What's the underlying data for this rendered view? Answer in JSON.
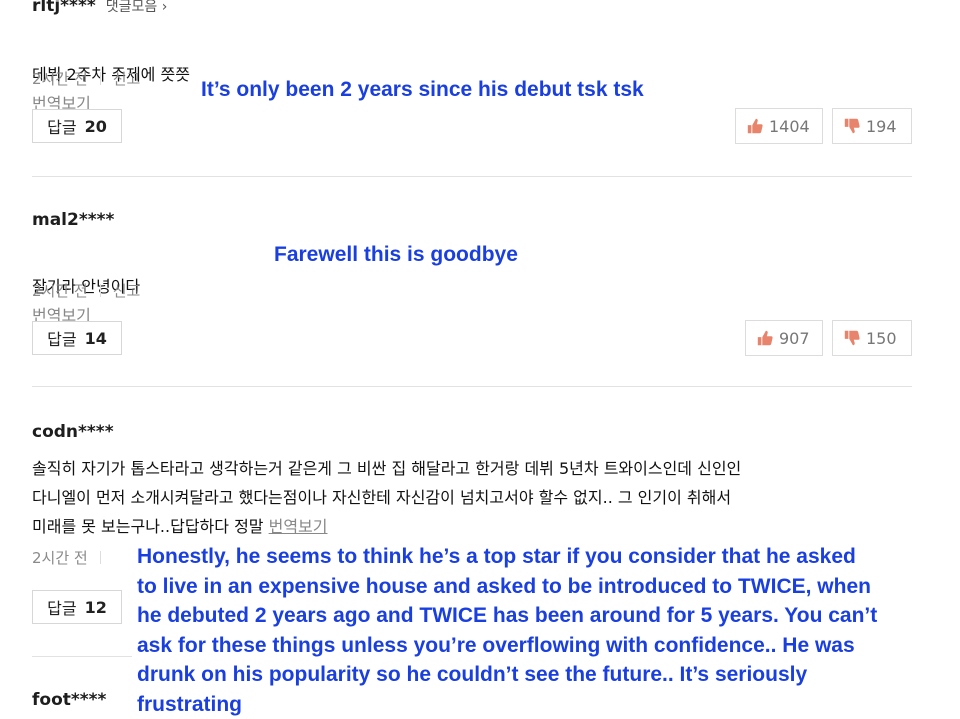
{
  "comments": [
    {
      "username": "rltj****",
      "collect_label": "댓글모음 ›",
      "text": "데뷔 2주차 주제에 쯧쯧",
      "translate_label": "번역보기",
      "time": "2시간 전",
      "report_label": "신고",
      "reply_label": "답글",
      "reply_count": "20",
      "likes": "1404",
      "dislikes": "194",
      "translation": "It’s only been 2 years since his debut tsk tsk"
    },
    {
      "username": "mal2****",
      "text": "잘가라 안녕이다",
      "translate_label": "번역보기",
      "time": "2시간 전",
      "report_label": "신고",
      "reply_label": "답글",
      "reply_count": "14",
      "likes": "907",
      "dislikes": "150",
      "translation": "Farewell this is goodbye"
    },
    {
      "username": "codn****",
      "text": "솔직히 자기가 톱스타라고 생각하는거 같은게 그 비싼 집 해달라고 한거랑 데뷔 5년차 트와이스인데 신인인\n다니엘이 먼저 소개시켜달라고 했다는점이나 자신한테 자신감이 넘치고서야 할수 없지.. 그 인기이 취해서\n미래를 못 보는구나..답답하다 정말",
      "translate_label": "번역보기",
      "time": "2시간 전",
      "reply_label": "답글",
      "reply_count": "12",
      "translation": "Honestly, he seems to think he’s a top star if you consider that he asked\nto live in an expensive house and asked to be introduced to TWICE, when\nhe debuted 2 years ago and TWICE has been around for 5 years. You can’t\nask for these things unless you’re overflowing with confidence.. He was\ndrunk on his popularity so he couldn’t see the future.. It’s seriously\nfrustrating"
    },
    {
      "username": "foot****"
    }
  ],
  "colors": {
    "translation_text": "#1a3fe0",
    "like_icon": "#e8846b",
    "dislike_icon": "#e8846b"
  },
  "icons": {
    "like": "thumbs-up-icon",
    "dislike": "thumbs-down-icon"
  }
}
